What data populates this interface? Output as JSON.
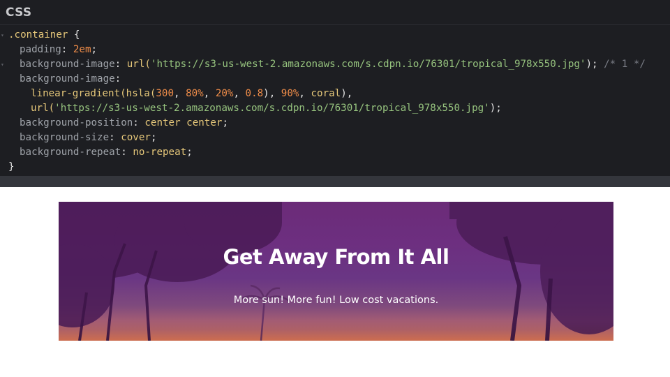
{
  "editor": {
    "title": "CSS"
  },
  "code": {
    "l1_selector": ".container",
    "l1_brace": " {",
    "l2_prop": "padding",
    "l2_value": "2em",
    "l3_prop": "background-image",
    "l3_fn": "url(",
    "l3_str": "'https://s3-us-west-2.amazonaws.com/s.cdpn.io/76301/tropical_978x550.jpg'",
    "l3_close": ");",
    "l3_comment": "/* 1 */",
    "l4_prop": "background-image",
    "l5_fn": "linear-gradient(hsla(",
    "l5_n1": "300",
    "l5_n2": "80%",
    "l5_n3": "20%",
    "l5_n4": "0.8",
    "l5_n5": "90%",
    "l5_kw": "coral",
    "l5_close": "),",
    "l6_fn": "url(",
    "l6_str": "'https://s3-us-west-2.amazonaws.com/s.cdpn.io/76301/tropical_978x550.jpg'",
    "l6_close": ");",
    "l7_prop": "background-position",
    "l7_value": "center center",
    "l8_prop": "background-size",
    "l8_value": "cover",
    "l9_prop": "background-repeat",
    "l9_value": "no-repeat",
    "l10_brace": "}"
  },
  "preview": {
    "title": "Get Away From It All",
    "text": "More sun! More fun! Low cost vacations."
  },
  "colors": {
    "editor_bg": "#1d1e22",
    "selector": "#e6c87a",
    "property": "#9fa3a9",
    "string": "#96c37e",
    "number": "#f08d49",
    "comment": "#7a7d86",
    "gradient_top": "#6b2b78",
    "gradient_bottom": "#f0805e"
  }
}
